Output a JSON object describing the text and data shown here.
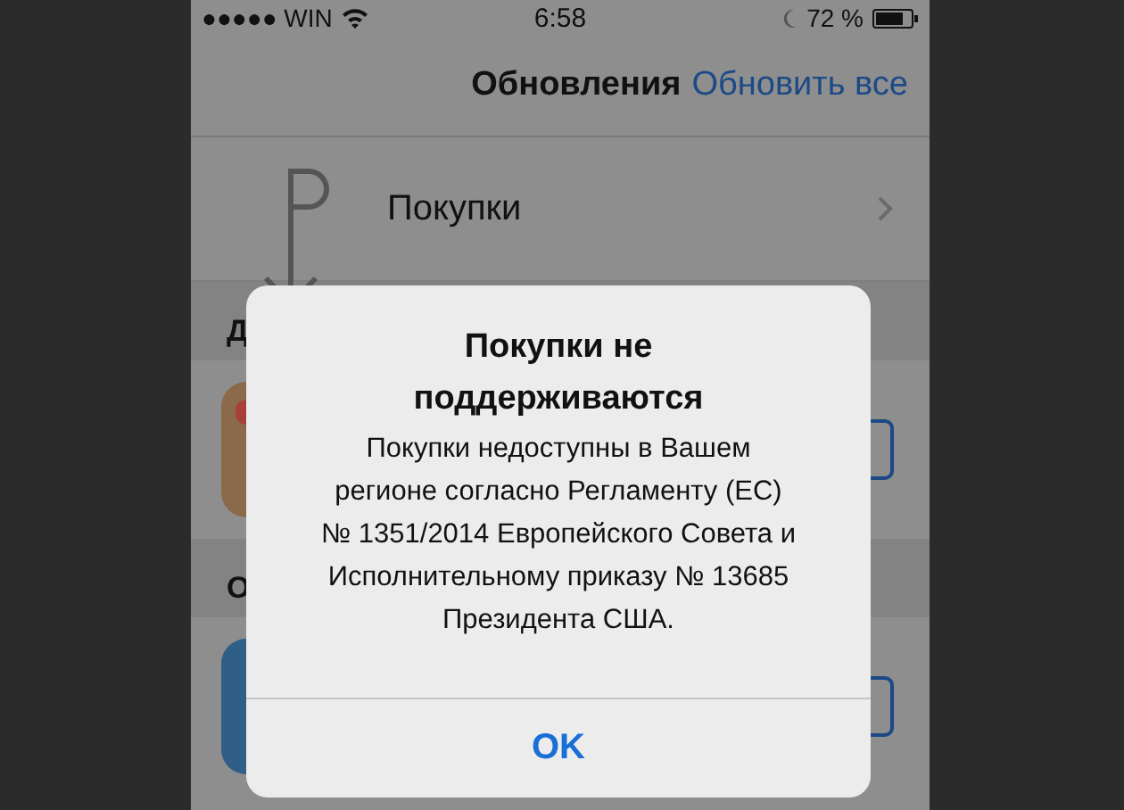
{
  "status_bar": {
    "carrier": "●●●●● WIN",
    "time": "6:58",
    "battery": "72 %"
  },
  "nav": {
    "title": "Обновления",
    "action": "Обновить все"
  },
  "purchases_row": {
    "label": "Покупки"
  },
  "sections": [
    {
      "header": "Д",
      "kind": "orange"
    },
    {
      "header": "О",
      "kind": "blue"
    }
  ],
  "alert": {
    "title": "Покупки не поддерживаются",
    "message": "Покупки недоступны в Вашем регионе согласно Регламенту (ЕС) № 1351/2014 Европейского Совета и Исполнительному приказу № 13685 Президента США.",
    "button": "OK"
  }
}
